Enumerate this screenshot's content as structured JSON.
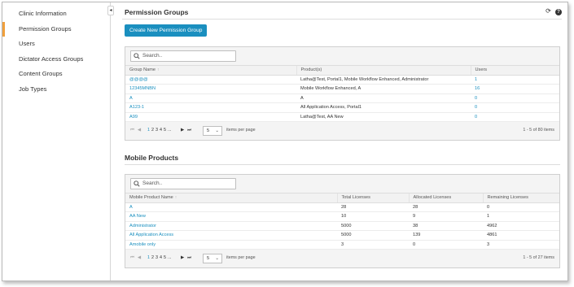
{
  "sidebar": {
    "items": [
      {
        "label": "Clinic Information"
      },
      {
        "label": "Permission Groups"
      },
      {
        "label": "Users"
      },
      {
        "label": "Dictator Access Groups"
      },
      {
        "label": "Content Groups"
      },
      {
        "label": "Job Types"
      }
    ],
    "active_index": 1,
    "collapse_glyph": "◂"
  },
  "header": {
    "title": "Permission Groups",
    "refresh_glyph": "⟳",
    "help_glyph": "?"
  },
  "permission_groups": {
    "create_label": "Create New Permission Group",
    "search_placeholder": "Search..",
    "columns": [
      "Group Name",
      "Product(s)",
      "Users"
    ],
    "rows": [
      {
        "name": "@@@@",
        "products": "Latha@Test, Portal1, Mobile Workflow Enhanced, Administrator",
        "users": "1"
      },
      {
        "name": "12345MNBN",
        "products": "Mobile Workflow Enhanced, A",
        "users": "16"
      },
      {
        "name": "A",
        "products": "A",
        "users": "0"
      },
      {
        "name": "A123-1",
        "products": "All Application Access, Portal1",
        "users": "0"
      },
      {
        "name": "A99",
        "products": "Latha@Test, AA New",
        "users": "0"
      }
    ],
    "pager": {
      "first": "⏮",
      "prev": "◀",
      "pages": [
        "1",
        "2",
        "3",
        "4",
        "5",
        "..."
      ],
      "current_page": "1",
      "next": "▶",
      "last": "⏭",
      "per_page": "5",
      "per_page_label": "items per page",
      "summary": "1 - 5 of 80 items"
    }
  },
  "mobile_products": {
    "title": "Mobile Products",
    "search_placeholder": "Search..",
    "columns": [
      "Mobile Product Name",
      "Total Licenses",
      "Allocated Licenses",
      "Remaining Licenses"
    ],
    "rows": [
      {
        "name": "A",
        "total": "28",
        "allocated": "28",
        "remaining": "0"
      },
      {
        "name": "AA New",
        "total": "10",
        "allocated": "9",
        "remaining": "1"
      },
      {
        "name": "Administrator",
        "total": "5000",
        "allocated": "38",
        "remaining": "4962"
      },
      {
        "name": "All Application Access",
        "total": "5000",
        "allocated": "139",
        "remaining": "4861"
      },
      {
        "name": "Amobile only",
        "total": "3",
        "allocated": "0",
        "remaining": "3"
      }
    ],
    "pager": {
      "first": "⏮",
      "prev": "◀",
      "pages": [
        "1",
        "2",
        "3",
        "4",
        "5",
        "..."
      ],
      "current_page": "1",
      "next": "▶",
      "last": "⏭",
      "per_page": "5",
      "per_page_label": "items per page",
      "summary": "1 - 5 of 27 items"
    }
  },
  "colors": {
    "accent": "#1a8fbf",
    "active_marker": "#f0a03c"
  }
}
